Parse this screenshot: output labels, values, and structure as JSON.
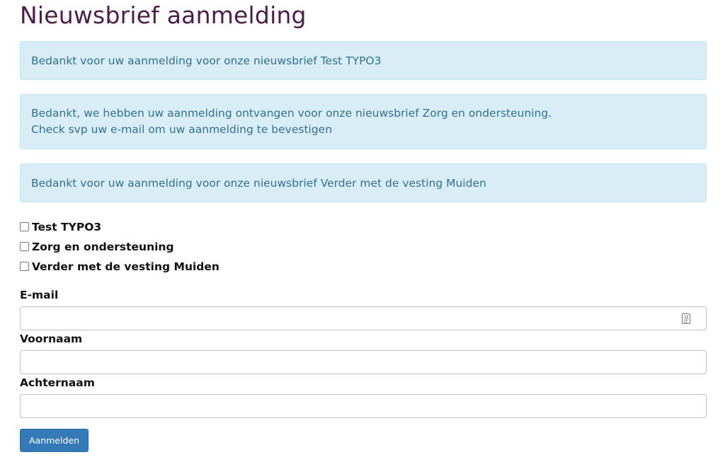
{
  "page": {
    "title": "Nieuwsbrief aanmelding"
  },
  "alerts": [
    {
      "lines": [
        "Bedankt voor uw aanmelding voor onze nieuwsbrief Test TYPO3"
      ]
    },
    {
      "lines": [
        "Bedankt, we hebben uw aanmelding ontvangen voor onze nieuwsbrief Zorg en ondersteuning.",
        "Check svp uw e-mail om uw aanmelding te bevestigen"
      ]
    },
    {
      "lines": [
        "Bedankt voor uw aanmelding voor onze nieuwsbrief Verder met de vesting Muiden"
      ]
    }
  ],
  "newsletters": [
    {
      "label": "Test TYPO3",
      "checked": false
    },
    {
      "label": "Zorg en ondersteuning",
      "checked": false
    },
    {
      "label": "Verder met de vesting Muiden",
      "checked": false
    }
  ],
  "form": {
    "email_label": "E-mail",
    "email_value": "",
    "firstname_label": "Voornaam",
    "firstname_value": "",
    "lastname_label": "Achternaam",
    "lastname_value": "",
    "submit_label": "Aanmelden"
  },
  "colors": {
    "title": "#4a1d4a",
    "alert_bg": "#d9edf7",
    "alert_text": "#31708f",
    "button_bg": "#337ab7"
  },
  "icons": {
    "email_field_icon": "contact-card-icon"
  }
}
